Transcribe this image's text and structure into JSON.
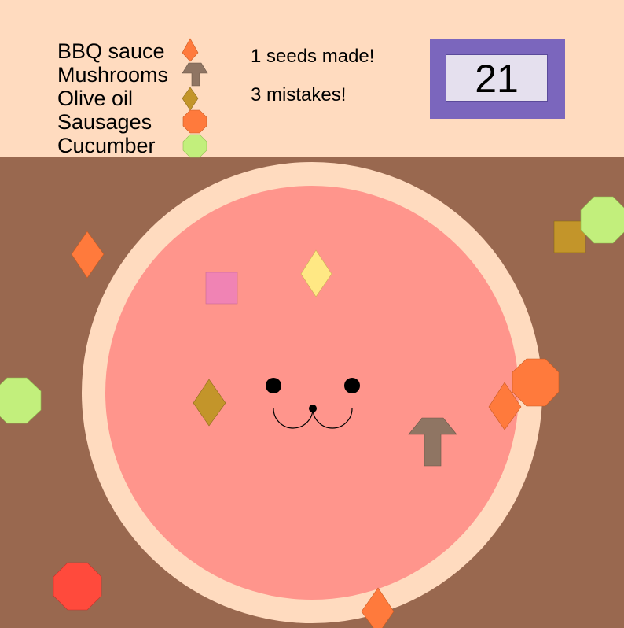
{
  "legend": [
    {
      "label": "BBQ sauce",
      "icon": "bbq-sauce-drop-icon",
      "color": "#ff7a3c"
    },
    {
      "label": "Mushrooms",
      "icon": "mushroom-icon",
      "color": "#8f7563"
    },
    {
      "label": "Olive oil",
      "icon": "olive-oil-drop-icon",
      "color": "#c3952a"
    },
    {
      "label": "Sausages",
      "icon": "sausage-octagon-icon",
      "color": "#ff7a3c"
    },
    {
      "label": "Cucumber",
      "icon": "cucumber-octagon-icon",
      "color": "#c2ef7c"
    }
  ],
  "status": {
    "seeds": "1 seeds made!",
    "mistakes": "3 mistakes!"
  },
  "timer": {
    "value": "21"
  },
  "colors": {
    "top_bar": "#ffdbbf",
    "table": "#99684f",
    "crust": "#ffdbbf",
    "sauce": "#ff958c",
    "timer_frame": "#7b66bd",
    "timer_box": "#e5e0ee"
  }
}
